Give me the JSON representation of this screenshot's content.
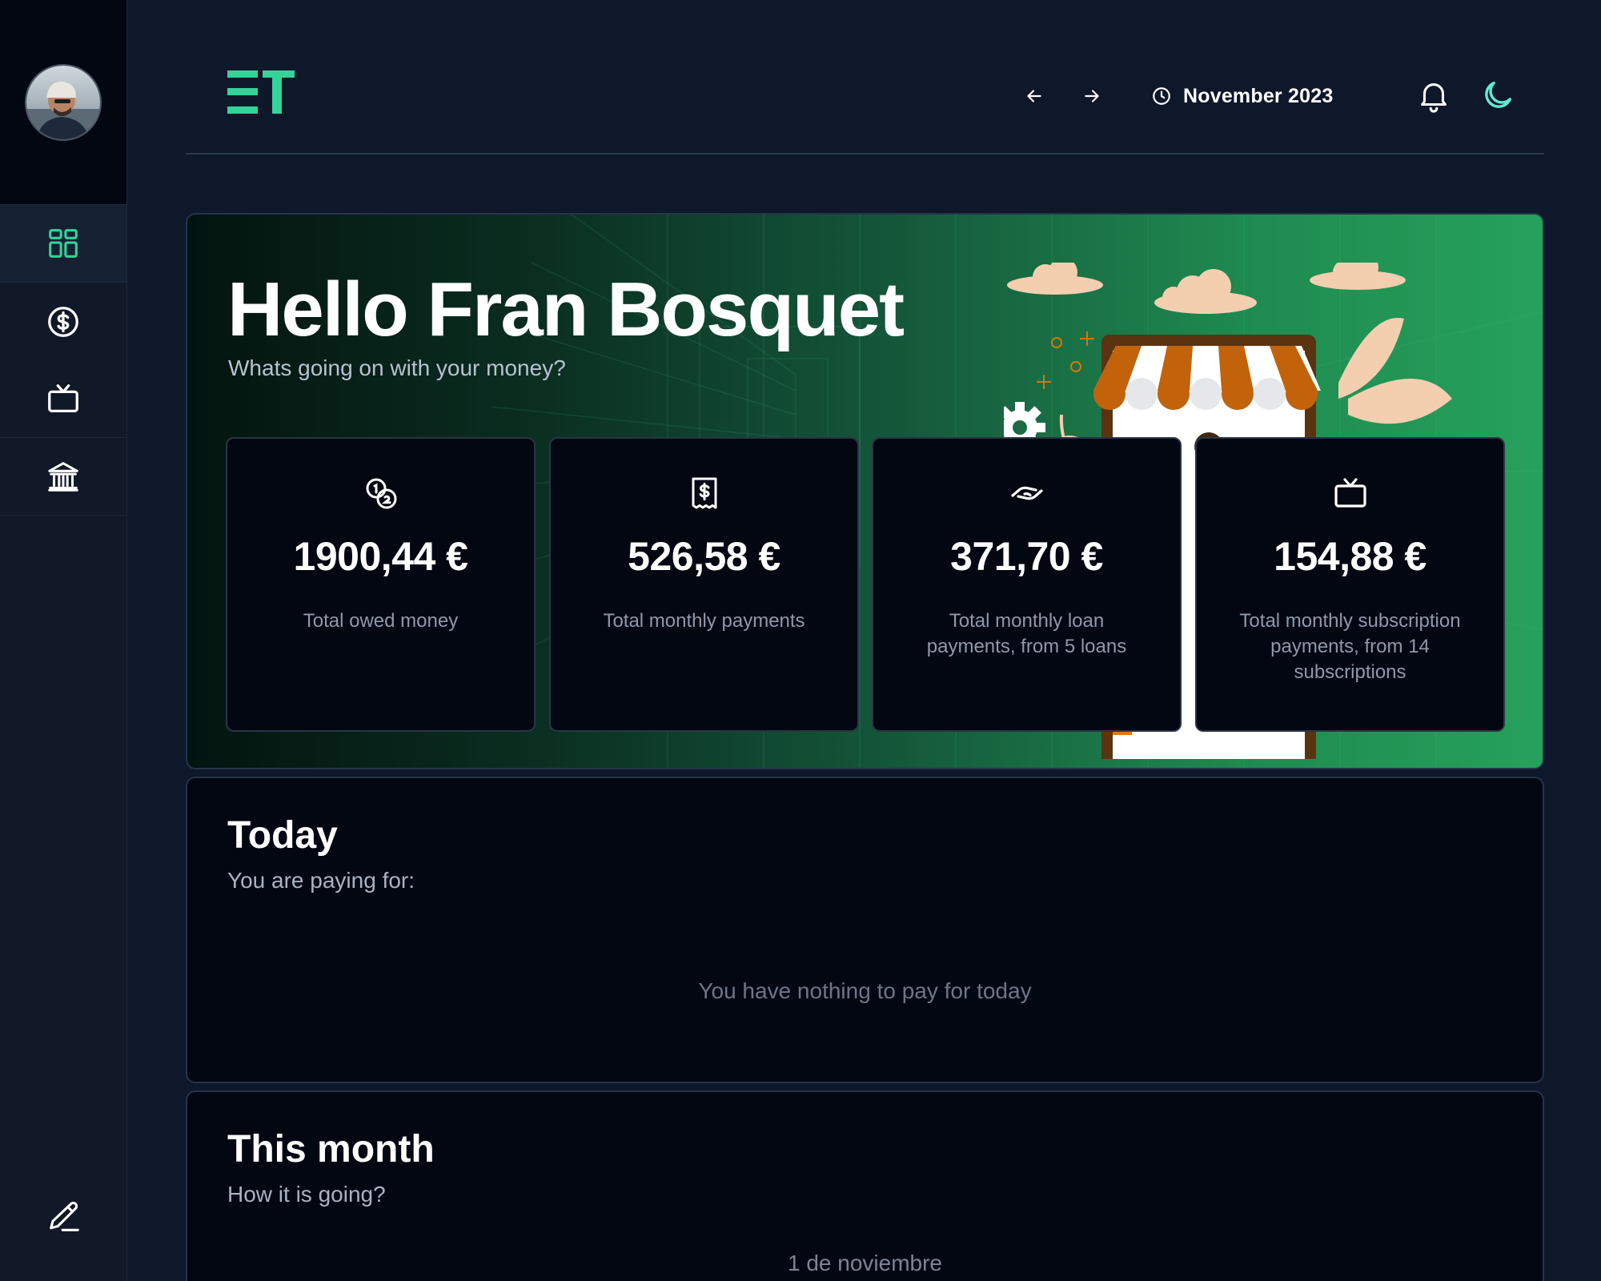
{
  "user": {
    "avatar_alt": "avatar"
  },
  "sidebar": {
    "items": [
      {
        "name": "dashboard",
        "icon": "grid-icon",
        "active": true
      },
      {
        "name": "payments",
        "icon": "dollar-circle-icon",
        "active": false
      },
      {
        "name": "subscriptions",
        "icon": "tv-icon",
        "active": false
      },
      {
        "name": "loans",
        "icon": "bank-icon",
        "active": false
      }
    ],
    "footer_icon": "pencil-icon"
  },
  "header": {
    "logo_text": "ET",
    "date_label": "November 2023",
    "icons": [
      "arrow-left-icon",
      "arrow-right-icon",
      "clock-icon",
      "bell-icon",
      "moon-icon"
    ]
  },
  "hero": {
    "title": "Hello Fran Bosquet",
    "subtitle": "Whats going on with your money?",
    "stats": [
      {
        "icon": "coins-icon",
        "amount": "1900,44 €",
        "label": "Total owed money"
      },
      {
        "icon": "receipt-icon",
        "amount": "526,58 €",
        "label": "Total monthly payments"
      },
      {
        "icon": "handshake-icon",
        "amount": "371,70 €",
        "label": "Total monthly loan payments, from 5 loans"
      },
      {
        "icon": "tv-icon",
        "amount": "154,88 €",
        "label": "Total monthly subscription payments, from 14 subscriptions"
      }
    ]
  },
  "today": {
    "title": "Today",
    "subtitle": "You are paying for:",
    "empty": "You have nothing to pay for today"
  },
  "month": {
    "title": "This month",
    "subtitle": "How it is going?",
    "first_day": "1 de noviembre"
  },
  "colors": {
    "accent": "#34d399",
    "moon": "#5eead4",
    "background": "#0f172a",
    "card": "#030712"
  }
}
